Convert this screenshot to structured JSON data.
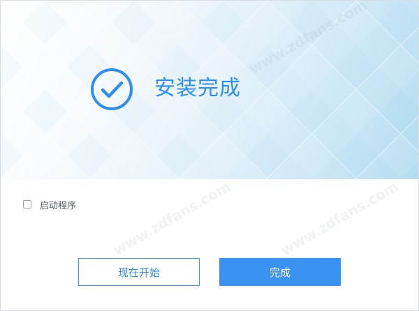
{
  "banner": {
    "title": "安装完成",
    "icon": "check-circle-icon",
    "accent_color": "#2f8cf0"
  },
  "options": {
    "launch_label": "启动程序",
    "launch_checked": false
  },
  "buttons": {
    "start_now_label": "现在开始",
    "finish_label": "完成",
    "primary_color": "#3a93f2"
  },
  "watermark": {
    "text": "www.zdfans.com"
  }
}
